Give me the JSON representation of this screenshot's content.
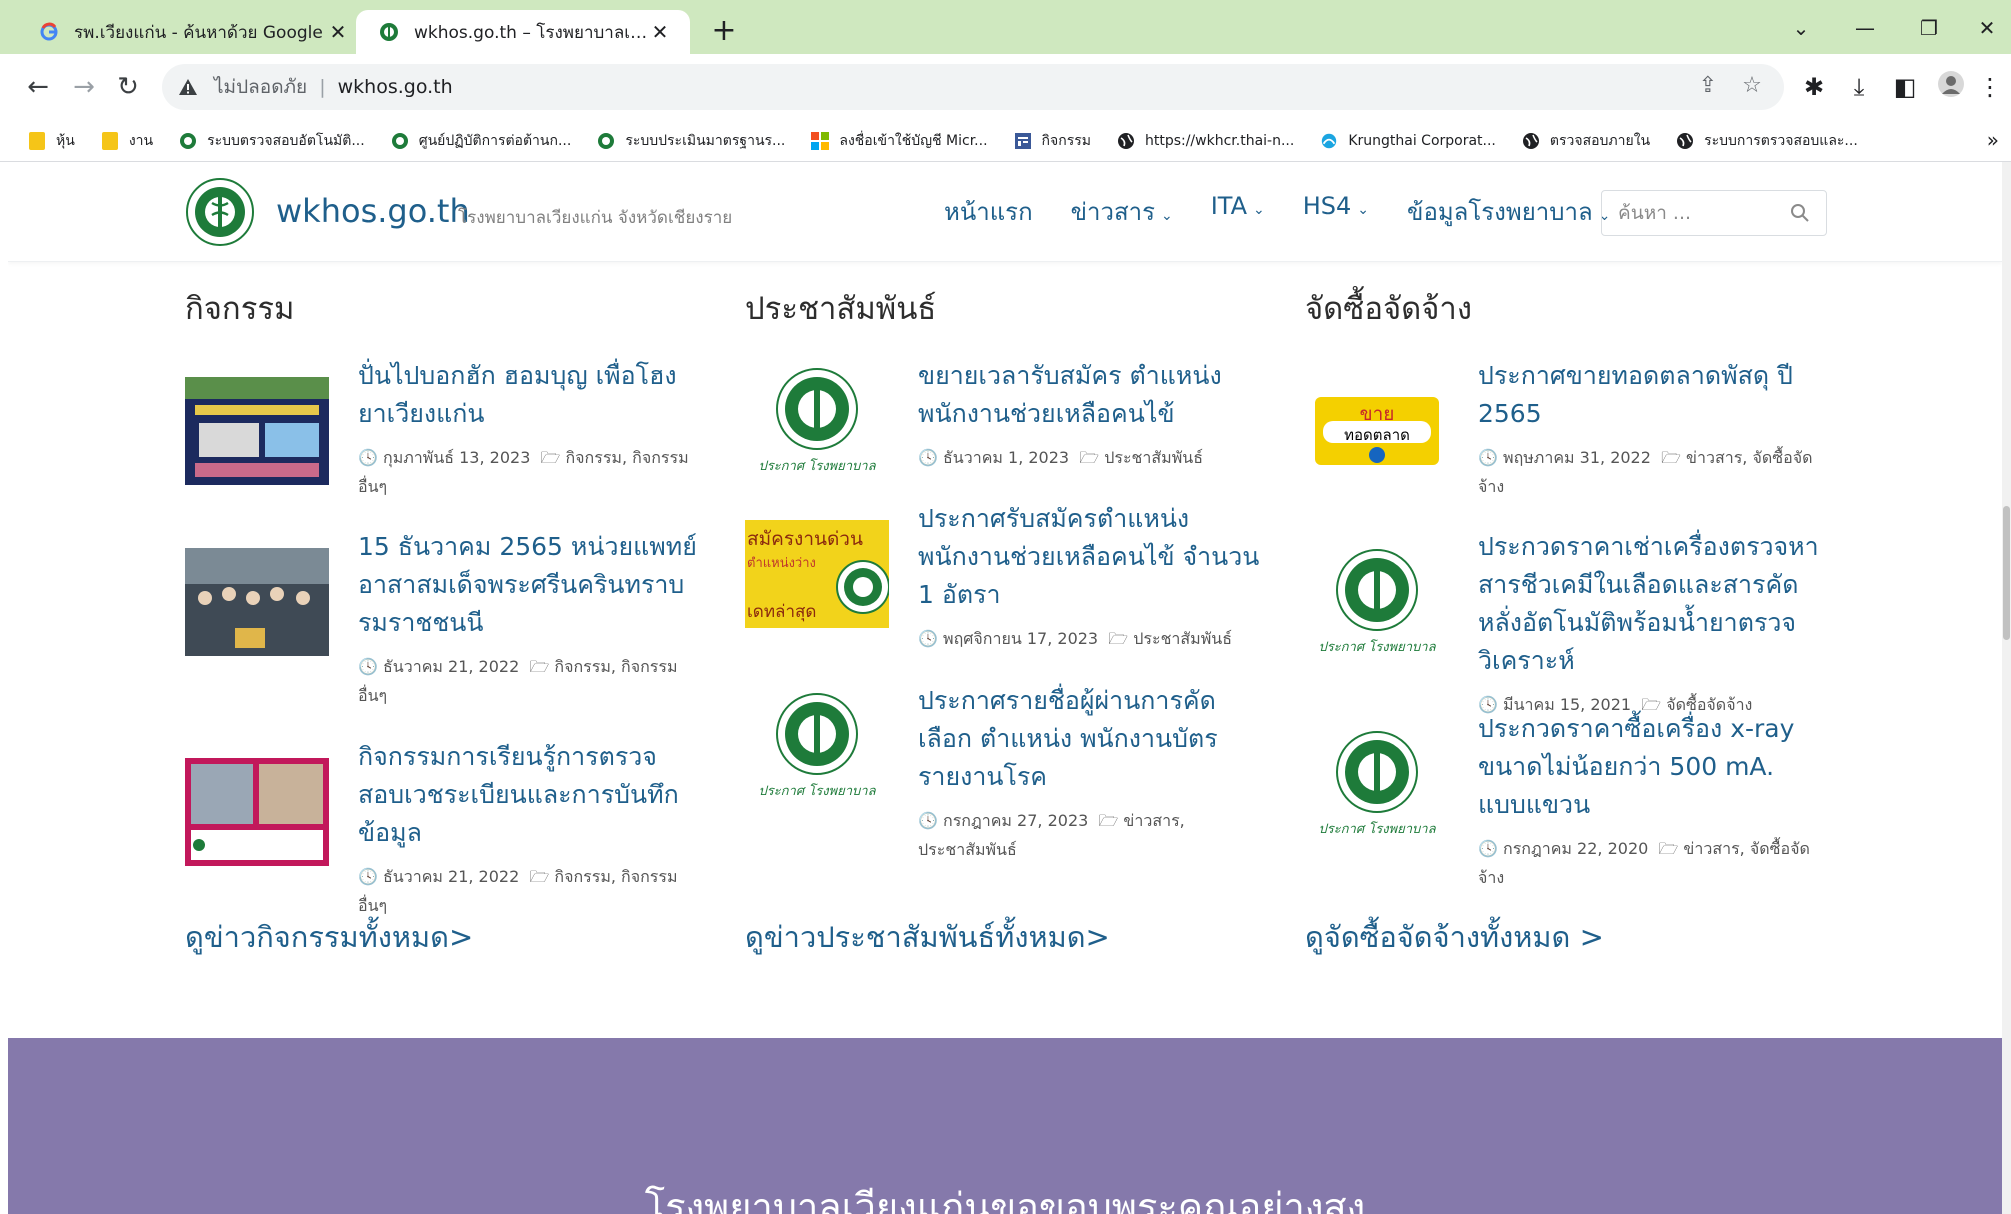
{
  "browser": {
    "tabs": [
      {
        "title": "รพ.เวียงแก่น - ค้นหาด้วย Google",
        "active": false
      },
      {
        "title": "wkhos.go.th – โรงพยาบาลเวียงแก่น",
        "active": true
      }
    ],
    "address": {
      "security_label": "ไม่ปลอดภัย",
      "url": "wkhos.go.th"
    },
    "bookmarks": [
      {
        "label": "หุ้น",
        "icon": "folder-icon"
      },
      {
        "label": "งาน",
        "icon": "folder-icon"
      },
      {
        "label": "ระบบตรวจสอบอัตโนมัติ...",
        "icon": "hospital-logo-icon"
      },
      {
        "label": "ศูนย์ปฏิบัติการต่อต้านก...",
        "icon": "hospital-logo-icon"
      },
      {
        "label": "ระบบประเมินมาตรฐานร...",
        "icon": "hospital-logo-icon"
      },
      {
        "label": "ลงชื่อเข้าใช้บัญชี Micr...",
        "icon": "microsoft-icon"
      },
      {
        "label": "กิจกรรม",
        "icon": "form-icon"
      },
      {
        "label": "https://wkhcr.thai-n...",
        "icon": "globe-icon"
      },
      {
        "label": "Krungthai Corporat...",
        "icon": "krungthai-icon"
      },
      {
        "label": "ตรวจสอบภายใน",
        "icon": "globe-icon"
      },
      {
        "label": "ระบบการตรวจสอบและ...",
        "icon": "globe-icon"
      }
    ],
    "bookmarks_more": "»"
  },
  "site": {
    "title": "wkhos.go.th",
    "description": "โรงพยาบาลเวียงแก่น จังหวัดเชียงราย",
    "nav": [
      "หน้าแรก",
      "ข่าวสาร",
      "ITA",
      "HS4",
      "ข้อมูลโรงพยาบาล"
    ],
    "search_placeholder": "ค้นหา ..."
  },
  "columns": [
    {
      "heading": "กิจกรรม",
      "view_all": "ดูข่าวกิจกรรมทั้งหมด>",
      "posts": [
        {
          "title": "ปั่นไปบอกฮัก ฮอมบุญ เพื่อโฮงยาเวียงแก่น",
          "date": "กุมภาพันธ์ 13, 2023",
          "cats": "กิจกรรม, กิจกรรมอื่นๆ"
        },
        {
          "title": "15 ธันวาคม 2565 หน่วยแพทย์อาสาสมเด็จพระศรีนครินทราบรมราชชนนี",
          "date": "ธันวาคม 21, 2022",
          "cats": "กิจกรรม, กิจกรรมอื่นๆ"
        },
        {
          "title": "กิจกรรมการเรียนรู้การตรวจสอบเวชระเบียนและการบันทึกข้อมูล",
          "date": "ธันวาคม 21, 2022",
          "cats": "กิจกรรม, กิจกรรมอื่นๆ"
        }
      ]
    },
    {
      "heading": "ประชาสัมพันธ์",
      "view_all": "ดูข่าวประชาสัมพันธ์ทั้งหมด>",
      "posts": [
        {
          "title": "ขยายเวลารับสมัคร ตำแหน่ง พนักงานช่วยเหลือคนไข้",
          "date": "ธันวาคม 1, 2023",
          "cats": "ประชาสัมพันธ์"
        },
        {
          "title": "ประกาศรับสมัครตำแหน่ง พนักงานช่วยเหลือคนไข้ จำนวน 1 อัตรา",
          "date": "พฤศจิกายน 17, 2023",
          "cats": "ประชาสัมพันธ์"
        },
        {
          "title": "ประกาศรายชื่อผู้ผ่านการคัดเลือก ตำแหน่ง พนักงานบัตรรายงานโรค",
          "date": "กรกฎาคม 27, 2023",
          "cats": "ข่าวสาร, ประชาสัมพันธ์"
        }
      ]
    },
    {
      "heading": "จัดซื้อจัดจ้าง",
      "view_all": "ดูจัดซื้อจัดจ้างทั้งหมด >",
      "posts": [
        {
          "title": "ประกาศขายทอดตลาดพัสดุ ปี 2565",
          "date": "พฤษภาคม 31, 2022",
          "cats": "ข่าวสาร, จัดซื้อจัดจ้าง"
        },
        {
          "title": "ประกวดราคาเช่าเครื่องตรวจหาสารชีวเคมีในเลือดและสารคัดหลั่งอัตโนมัติพร้อมน้ำยาตรวจวิเคราะห์",
          "date": "มีนาคม 15, 2021",
          "cats": "จัดซื้อจัดจ้าง"
        },
        {
          "title": "ประกวดราคาซื้อเครื่อง x-ray ขนาดไม่น้อยกว่า 500 mA. แบบแขวน",
          "date": "กรกฎาคม 22, 2020",
          "cats": "ข่าวสาร, จัดซื้อจัดจ้าง"
        }
      ]
    }
  ],
  "thumb_text": {
    "announce": "ประกาศ โรงพยาบาล",
    "recruit_top": "สมัครงานด่วน",
    "recruit_mid": "ตำแหน่งว่าง",
    "recruit_bottom": "เดทล่าสุด",
    "sale_top": "ขาย",
    "sale_mid": "ทอดตลาด"
  },
  "footer": {
    "text": "โรงพยาบาลเวียงแก่นขอขอบพระคุณอย่างสูง"
  },
  "colors": {
    "link": "#1f5f8b",
    "footer_bg": "#8579ab",
    "tabstrip": "#cfe8bf"
  }
}
